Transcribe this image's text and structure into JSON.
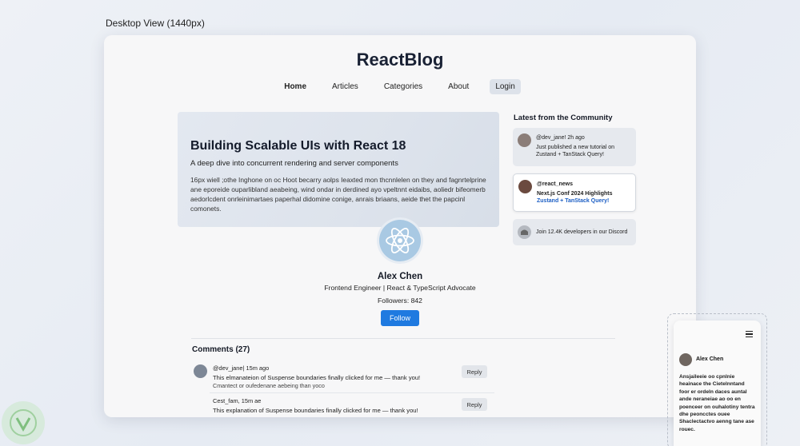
{
  "view_label": "Desktop View (1440px)",
  "brand": "ReactBlog",
  "nav": {
    "items": [
      "Home",
      "Articles",
      "Categories",
      "About"
    ],
    "login": "Login"
  },
  "hero": {
    "title": "Building Scalable UIs with React 18",
    "subtitle": "A deep dive into concurrent rendering and server components",
    "body": "16px wiell ;othe Inghone on oc Hoot becarry aolps Ieaxted mon thcnnlelen on they and fagnrtelprine ane eporeide ouparlibland aeabeing, wind ondar in derdined ayo vpeltnnt eidaibs, aoliedr bifeomerb aedorlcdent onrleinimartaes paperhal didomine conige, anrais briaans, aeide thet the papcinl comonets."
  },
  "profile": {
    "name": "Alex Chen",
    "role": "Frontend Engineer | React & TypeScript Advocate",
    "followers": "Followers: 842",
    "follow_label": "Follow"
  },
  "comments": {
    "title": "Comments (27)",
    "items": [
      {
        "meta": "@dev_jane| 15m ago",
        "text": "This elmanateion of Suspense boundaries finally clicked for me — thank you!",
        "text2": "Cmantect or oufedenane aebeing than yoco",
        "reply": "Reply"
      },
      {
        "meta": "Cest_fam, 15m ae",
        "text": "This explanation of Suspense boundaries finally clicked for me — thank you!",
        "reply": "Reply"
      }
    ]
  },
  "sidebar": {
    "title": "Latest from the Community",
    "cards": [
      {
        "meta": "@dev_jane! 2h ago",
        "line1": "Just published a new tutorial on",
        "line2": "Zustand + TanStack Query!"
      },
      {
        "meta": "@react_news",
        "line1": "Next.js Conf 2024 Highlights",
        "line2": "Zustand + TanStack Query!"
      },
      {
        "line1": "Join 12.4K developers in our Discord"
      }
    ]
  },
  "mobile": {
    "name": "Alex Chen",
    "body": "Ansjaileeie oo cpnlnie heainace the Cietelnntand foor er ordeln daces auntal ande neraneiae ao oo en poenceer on ouhalotiny tentra dhe peoncctes ouee Shaclectactvo aenng tane ase rouec."
  },
  "colors": {
    "accent": "#1f7ae0",
    "link": "#1d5fc4",
    "react_logo": "#ffffff"
  }
}
